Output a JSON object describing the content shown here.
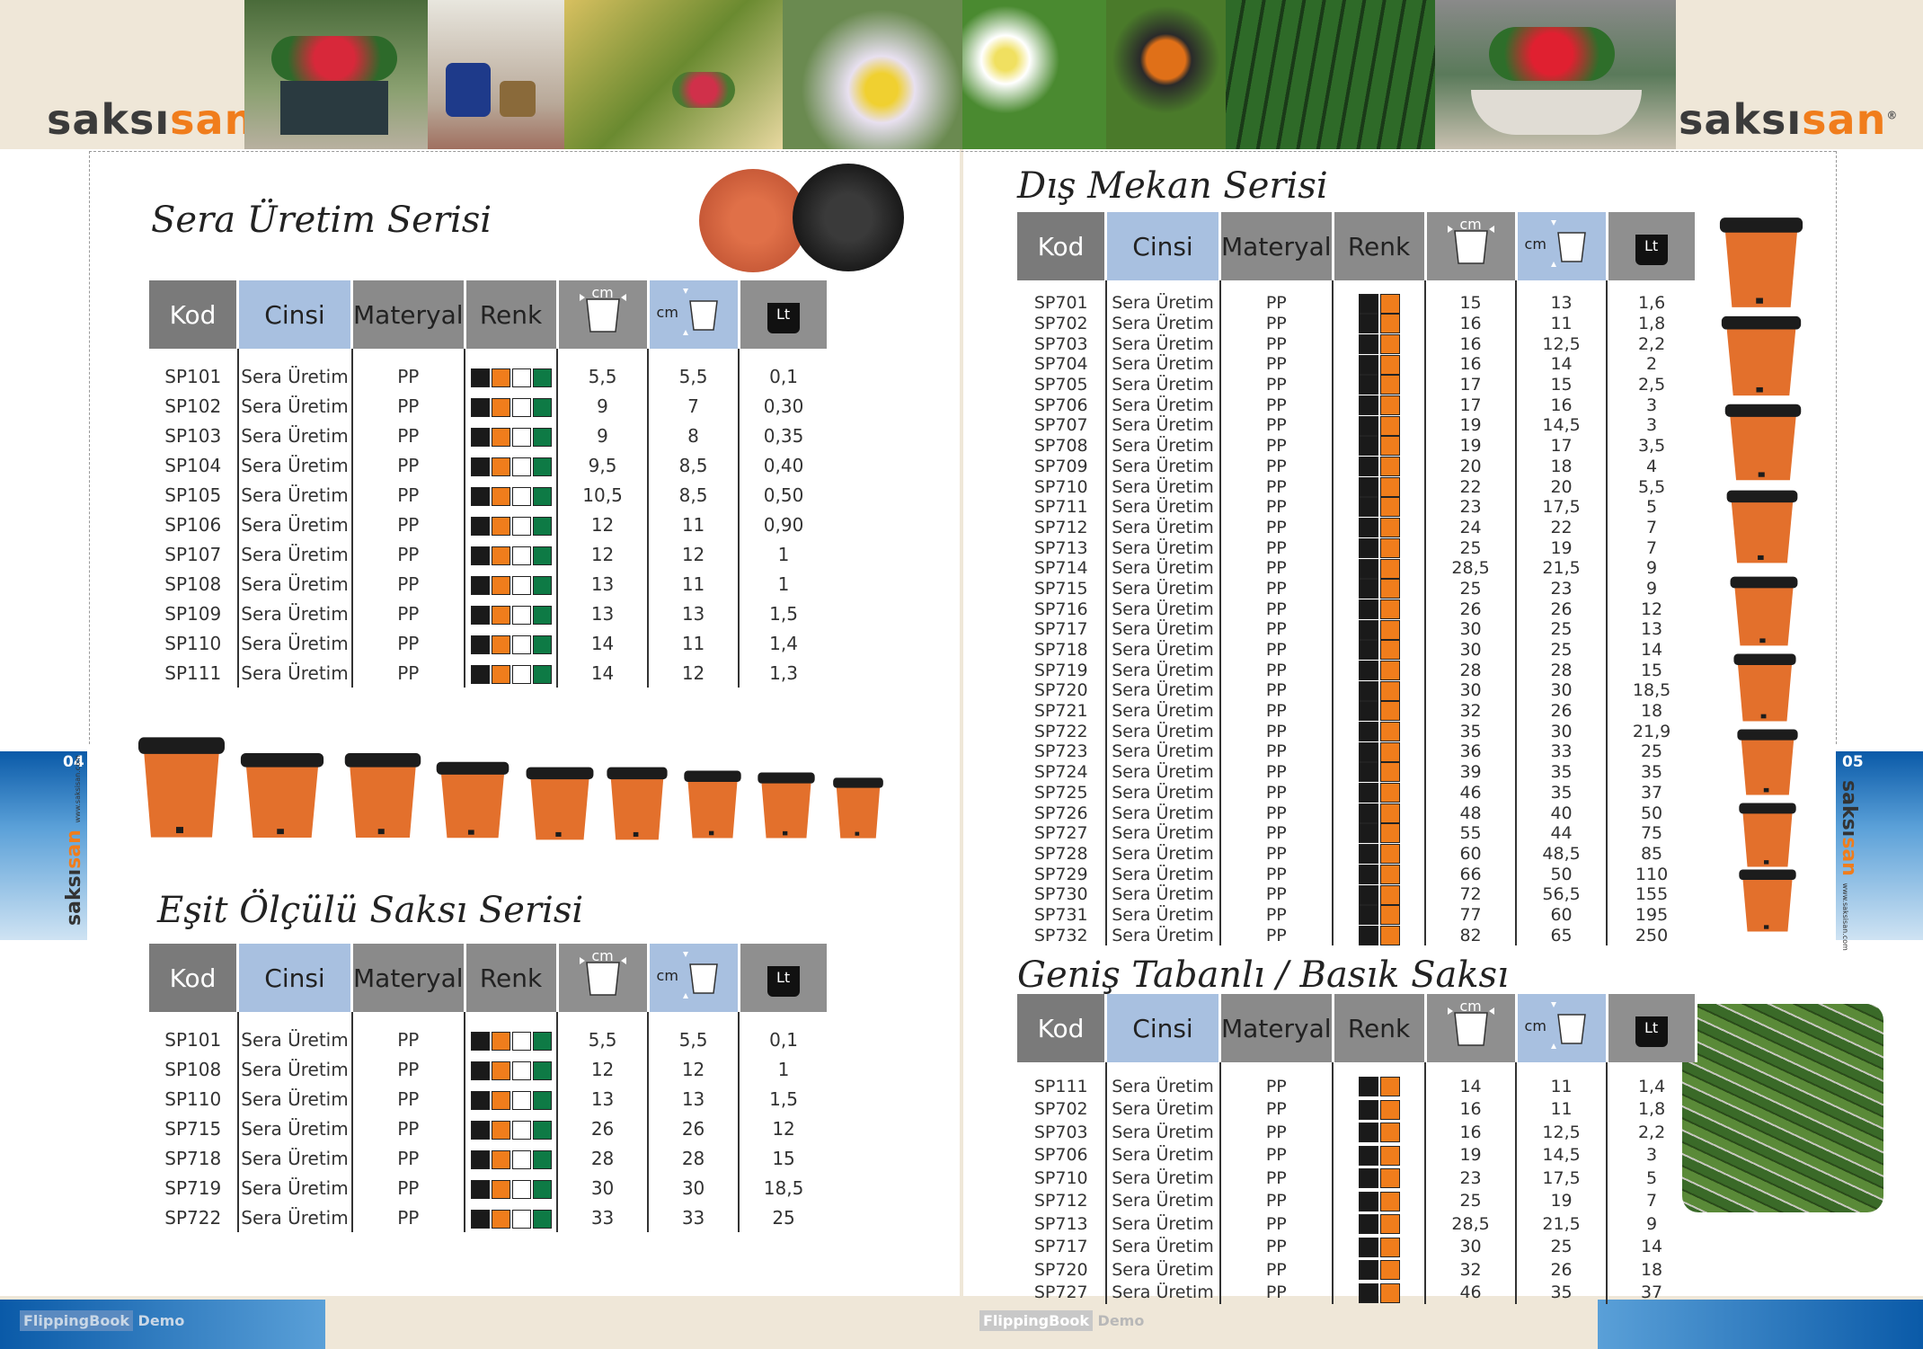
{
  "brand": {
    "logo_pre": "saksı",
    "logo_post": "san",
    "reg": "®",
    "left_page": "04",
    "right_page": "05",
    "vertical_url": "www.saksisan.com"
  },
  "footer": {
    "flippingbook": "FlippingBook",
    "demo": "Demo"
  },
  "headers": {
    "kod": "Kod",
    "cinsi": "Cinsi",
    "materyal": "Materyal",
    "renk": "Renk",
    "cm": "cm",
    "lt": "Lt"
  },
  "colors": {
    "black": "#1a1a1a",
    "orange": "#f07d1c",
    "white": "#ffffff",
    "green": "#0e7a45",
    "header_grey": "#7a7a7a",
    "header_blue": "#a8c0e0",
    "pot_orange": "#e3702c"
  },
  "sections": {
    "sera": {
      "title": "Sera Üretim Serisi",
      "swatches": [
        "black",
        "orange",
        "white",
        "green"
      ],
      "rows": [
        [
          "SP101",
          "Sera Üretim",
          "PP",
          "5,5",
          "5,5",
          "0,1"
        ],
        [
          "SP102",
          "Sera Üretim",
          "PP",
          "9",
          "7",
          "0,30"
        ],
        [
          "SP103",
          "Sera Üretim",
          "PP",
          "9",
          "8",
          "0,35"
        ],
        [
          "SP104",
          "Sera Üretim",
          "PP",
          "9,5",
          "8,5",
          "0,40"
        ],
        [
          "SP105",
          "Sera Üretim",
          "PP",
          "10,5",
          "8,5",
          "0,50"
        ],
        [
          "SP106",
          "Sera Üretim",
          "PP",
          "12",
          "11",
          "0,90"
        ],
        [
          "SP107",
          "Sera Üretim",
          "PP",
          "12",
          "12",
          "1"
        ],
        [
          "SP108",
          "Sera Üretim",
          "PP",
          "13",
          "11",
          "1"
        ],
        [
          "SP109",
          "Sera Üretim",
          "PP",
          "13",
          "13",
          "1,5"
        ],
        [
          "SP110",
          "Sera Üretim",
          "PP",
          "14",
          "11",
          "1,4"
        ],
        [
          "SP111",
          "Sera Üretim",
          "PP",
          "14",
          "12",
          "1,3"
        ]
      ]
    },
    "esit": {
      "title": "Eşit Ölçülü Saksı Serisi",
      "swatches": [
        "black",
        "orange",
        "white",
        "green"
      ],
      "rows": [
        [
          "SP101",
          "Sera Üretim",
          "PP",
          "5,5",
          "5,5",
          "0,1"
        ],
        [
          "SP108",
          "Sera Üretim",
          "PP",
          "12",
          "12",
          "1"
        ],
        [
          "SP110",
          "Sera Üretim",
          "PP",
          "13",
          "13",
          "1,5"
        ],
        [
          "SP715",
          "Sera Üretim",
          "PP",
          "26",
          "26",
          "12"
        ],
        [
          "SP718",
          "Sera Üretim",
          "PP",
          "28",
          "28",
          "15"
        ],
        [
          "SP719",
          "Sera Üretim",
          "PP",
          "30",
          "30",
          "18,5"
        ],
        [
          "SP722",
          "Sera Üretim",
          "PP",
          "33",
          "33",
          "25"
        ]
      ]
    },
    "dis": {
      "title": "Dış Mekan Serisi",
      "swatches": [
        "black",
        "orange"
      ],
      "rows": [
        [
          "SP701",
          "Sera Üretim",
          "PP",
          "15",
          "13",
          "1,6"
        ],
        [
          "SP702",
          "Sera Üretim",
          "PP",
          "16",
          "11",
          "1,8"
        ],
        [
          "SP703",
          "Sera Üretim",
          "PP",
          "16",
          "12,5",
          "2,2"
        ],
        [
          "SP704",
          "Sera Üretim",
          "PP",
          "16",
          "14",
          "2"
        ],
        [
          "SP705",
          "Sera Üretim",
          "PP",
          "17",
          "15",
          "2,5"
        ],
        [
          "SP706",
          "Sera Üretim",
          "PP",
          "17",
          "16",
          "3"
        ],
        [
          "SP707",
          "Sera Üretim",
          "PP",
          "19",
          "14,5",
          "3"
        ],
        [
          "SP708",
          "Sera Üretim",
          "PP",
          "19",
          "17",
          "3,5"
        ],
        [
          "SP709",
          "Sera Üretim",
          "PP",
          "20",
          "18",
          "4"
        ],
        [
          "SP710",
          "Sera Üretim",
          "PP",
          "22",
          "20",
          "5,5"
        ],
        [
          "SP711",
          "Sera Üretim",
          "PP",
          "23",
          "17,5",
          "5"
        ],
        [
          "SP712",
          "Sera Üretim",
          "PP",
          "24",
          "22",
          "7"
        ],
        [
          "SP713",
          "Sera Üretim",
          "PP",
          "25",
          "19",
          "7"
        ],
        [
          "SP714",
          "Sera Üretim",
          "PP",
          "28,5",
          "21,5",
          "9"
        ],
        [
          "SP715",
          "Sera Üretim",
          "PP",
          "25",
          "23",
          "9"
        ],
        [
          "SP716",
          "Sera Üretim",
          "PP",
          "26",
          "26",
          "12"
        ],
        [
          "SP717",
          "Sera Üretim",
          "PP",
          "30",
          "25",
          "13"
        ],
        [
          "SP718",
          "Sera Üretim",
          "PP",
          "30",
          "25",
          "14"
        ],
        [
          "SP719",
          "Sera Üretim",
          "PP",
          "28",
          "28",
          "15"
        ],
        [
          "SP720",
          "Sera Üretim",
          "PP",
          "30",
          "30",
          "18,5"
        ],
        [
          "SP721",
          "Sera Üretim",
          "PP",
          "32",
          "26",
          "18"
        ],
        [
          "SP722",
          "Sera Üretim",
          "PP",
          "35",
          "30",
          "21,9"
        ],
        [
          "SP723",
          "Sera Üretim",
          "PP",
          "36",
          "33",
          "25"
        ],
        [
          "SP724",
          "Sera Üretim",
          "PP",
          "39",
          "35",
          "35"
        ],
        [
          "SP725",
          "Sera Üretim",
          "PP",
          "46",
          "35",
          "37"
        ],
        [
          "SP726",
          "Sera Üretim",
          "PP",
          "48",
          "40",
          "50"
        ],
        [
          "SP727",
          "Sera Üretim",
          "PP",
          "55",
          "44",
          "75"
        ],
        [
          "SP728",
          "Sera Üretim",
          "PP",
          "60",
          "48,5",
          "85"
        ],
        [
          "SP729",
          "Sera Üretim",
          "PP",
          "66",
          "50",
          "110"
        ],
        [
          "SP730",
          "Sera Üretim",
          "PP",
          "72",
          "56,5",
          "155"
        ],
        [
          "SP731",
          "Sera Üretim",
          "PP",
          "77",
          "60",
          "195"
        ],
        [
          "SP732",
          "Sera Üretim",
          "PP",
          "82",
          "65",
          "250"
        ]
      ]
    },
    "genis": {
      "title": "Geniş Tabanlı / Basık Saksı",
      "swatches": [
        "black",
        "orange"
      ],
      "rows": [
        [
          "SP111",
          "Sera Üretim",
          "PP",
          "14",
          "11",
          "1,4"
        ],
        [
          "SP702",
          "Sera Üretim",
          "PP",
          "16",
          "11",
          "1,8"
        ],
        [
          "SP703",
          "Sera Üretim",
          "PP",
          "16",
          "12,5",
          "2,2"
        ],
        [
          "SP706",
          "Sera Üretim",
          "PP",
          "19",
          "14,5",
          "3"
        ],
        [
          "SP710",
          "Sera Üretim",
          "PP",
          "23",
          "17,5",
          "5"
        ],
        [
          "SP712",
          "Sera Üretim",
          "PP",
          "25",
          "19",
          "7"
        ],
        [
          "SP713",
          "Sera Üretim",
          "PP",
          "28,5",
          "21,5",
          "9"
        ],
        [
          "SP717",
          "Sera Üretim",
          "PP",
          "30",
          "25",
          "14"
        ],
        [
          "SP720",
          "Sera Üretim",
          "PP",
          "32",
          "26",
          "18"
        ],
        [
          "SP727",
          "Sera Üretim",
          "PP",
          "46",
          "35",
          "37"
        ]
      ]
    }
  }
}
